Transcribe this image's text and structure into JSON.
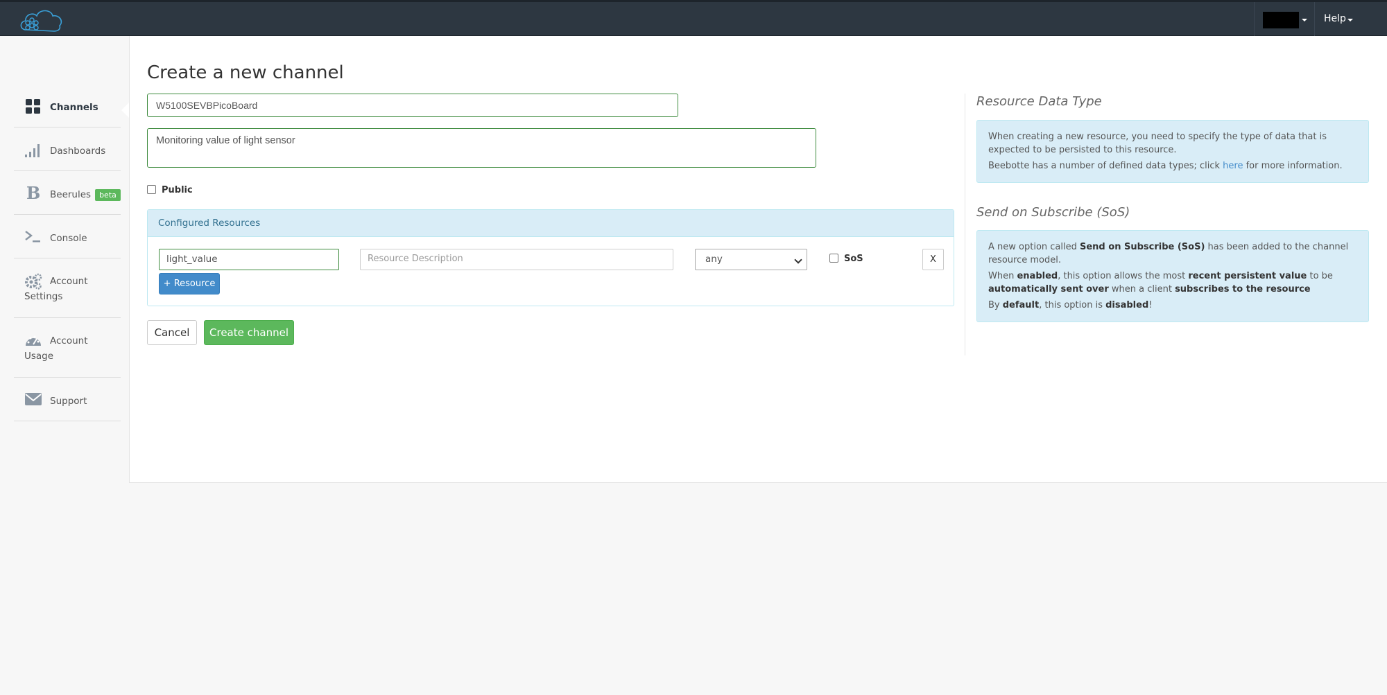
{
  "header": {
    "help_label": "Help"
  },
  "sidebar": {
    "items": [
      {
        "label": "Channels"
      },
      {
        "label": "Dashboards"
      },
      {
        "label": "Beerules",
        "badge": "beta"
      },
      {
        "label": "Console"
      },
      {
        "label": "Account Settings"
      },
      {
        "label": "Account Usage"
      },
      {
        "label": "Support"
      }
    ]
  },
  "form": {
    "title": "Create a new channel",
    "channel_name": "W5100SEVBPicoBoard",
    "channel_description": "Monitoring value of light sensor",
    "public_label": "Public",
    "resources_header": "Configured Resources",
    "resource": {
      "name": "light_value",
      "description_placeholder": "Resource Description",
      "type": "any",
      "sos_label": "SoS",
      "remove_label": "X"
    },
    "add_resource_label": "+ Resource",
    "cancel_label": "Cancel",
    "create_label": "Create channel"
  },
  "help": {
    "data_type": {
      "title": "Resource Data Type",
      "p1": "When creating a new resource, you need to specify the type of data that is expected to be persisted to this resource.",
      "p2_before": "Beebotte has a number of defined data types; click ",
      "p2_link": "here",
      "p2_after": " for more information."
    },
    "sos": {
      "title": "Send on Subscribe (SoS)",
      "p1_a": "A new option called ",
      "p1_b": "Send on Subscribe (SoS)",
      "p1_c": " has been added to the channel resource model.",
      "p2_a": "When ",
      "p2_b": "enabled",
      "p2_c": ", this option allows the most ",
      "p2_d": "recent persistent value",
      "p2_e": " to be ",
      "p2_f": "automatically sent over",
      "p2_g": " when a client ",
      "p2_h": "subscribes to the resource",
      "p3_a": "By ",
      "p3_b": "default",
      "p3_c": ", this option is ",
      "p3_d": "disabled",
      "p3_e": "!"
    }
  }
}
